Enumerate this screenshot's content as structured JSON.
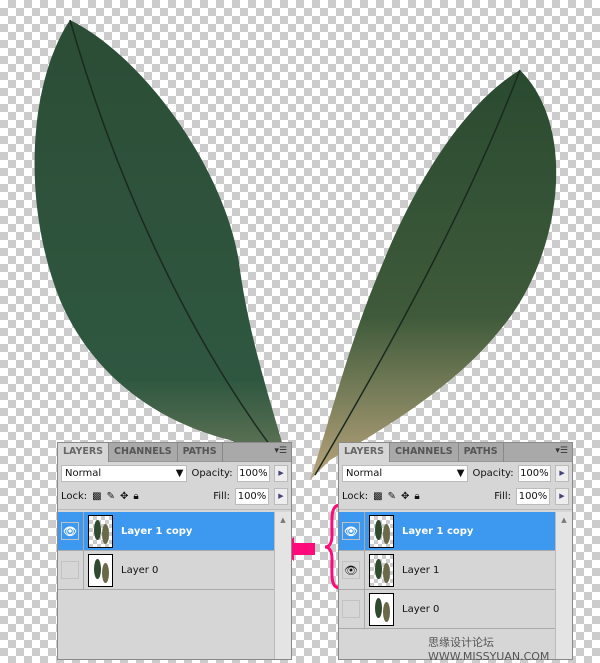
{
  "panel_tabs": [
    "LAYERS",
    "CHANNELS",
    "PATHS"
  ],
  "blend_mode": "Normal",
  "opacity_label": "Opacity:",
  "opacity_value": "100%",
  "lock_label": "Lock:",
  "fill_label": "Fill:",
  "fill_value": "100%",
  "left_panel": {
    "layers": [
      {
        "name": "Layer 1 copy",
        "visible": true,
        "selected": true
      },
      {
        "name": "Layer 0",
        "visible": false,
        "selected": false
      }
    ]
  },
  "right_panel": {
    "layers": [
      {
        "name": "Layer 1 copy",
        "visible": true,
        "selected": true
      },
      {
        "name": "Layer 1",
        "visible": true,
        "selected": false
      },
      {
        "name": "Layer 0",
        "visible": false,
        "selected": false
      }
    ]
  },
  "accent_color": "#ff0a7a",
  "selection_color": "#3d98f0",
  "watermark": "思缘设计论坛 WWW.MISSYUAN.COM"
}
